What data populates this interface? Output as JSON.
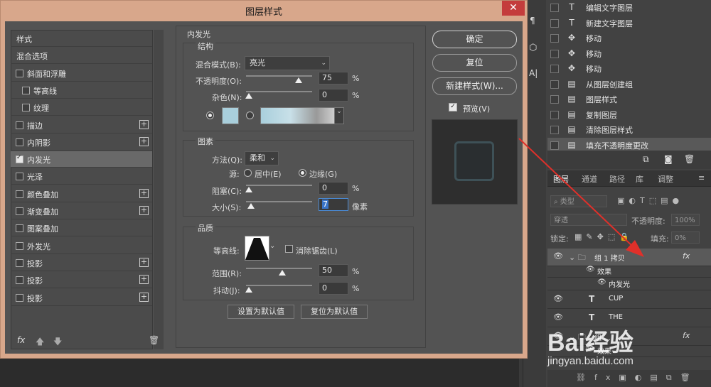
{
  "history": {
    "items": [
      {
        "icon": "T",
        "label": "编辑文字图层"
      },
      {
        "icon": "T",
        "label": "新建文字图层"
      },
      {
        "icon": "✥",
        "label": "移动"
      },
      {
        "icon": "✥",
        "label": "移动"
      },
      {
        "icon": "✥",
        "label": "移动"
      },
      {
        "icon": "▤",
        "label": "从图层创建组"
      },
      {
        "icon": "▤",
        "label": "图层样式"
      },
      {
        "icon": "▤",
        "label": "复制图层"
      },
      {
        "icon": "▤",
        "label": "清除图层样式"
      },
      {
        "icon": "▤",
        "label": "填充不透明度更改"
      }
    ]
  },
  "layers_panel": {
    "tabs": [
      "图层",
      "通道",
      "路径",
      "库",
      "调整"
    ],
    "filter_placeholder": "类型",
    "blend": "穿透",
    "opacity_label": "不透明度:",
    "opacity_value": "100%",
    "lock_label": "锁定:",
    "fill_label": "填充:",
    "fill_value": "0%",
    "rows": [
      {
        "name": "组 1 拷贝",
        "type": "group",
        "fx": "fx"
      },
      {
        "name": "效果",
        "type": "effect"
      },
      {
        "name": "内发光",
        "type": "effect"
      },
      {
        "name": "CUP",
        "type": "text"
      },
      {
        "name": "THE",
        "type": "text"
      },
      {
        "name": "组 ...",
        "type": "group",
        "fx": "fx"
      },
      {
        "name": "效果",
        "type": "effect"
      }
    ]
  },
  "dialog": {
    "title": "图层样式",
    "close": "✕",
    "left_list": [
      {
        "label": "样式",
        "checkbox": false,
        "plus": false,
        "indent": 0
      },
      {
        "label": "混合选项",
        "checkbox": false,
        "plus": false,
        "indent": 0
      },
      {
        "label": "斜面和浮雕",
        "checkbox": true,
        "checked": false,
        "plus": false,
        "indent": 0
      },
      {
        "label": "等高线",
        "checkbox": true,
        "checked": false,
        "plus": false,
        "indent": 1
      },
      {
        "label": "纹理",
        "checkbox": true,
        "checked": false,
        "plus": false,
        "indent": 1
      },
      {
        "label": "描边",
        "checkbox": true,
        "checked": false,
        "plus": true,
        "indent": 0
      },
      {
        "label": "内阴影",
        "checkbox": true,
        "checked": false,
        "plus": true,
        "indent": 0
      },
      {
        "label": "内发光",
        "checkbox": true,
        "checked": true,
        "plus": false,
        "indent": 0,
        "selected": true
      },
      {
        "label": "光泽",
        "checkbox": true,
        "checked": false,
        "plus": false,
        "indent": 0
      },
      {
        "label": "颜色叠加",
        "checkbox": true,
        "checked": false,
        "plus": true,
        "indent": 0
      },
      {
        "label": "渐变叠加",
        "checkbox": true,
        "checked": false,
        "plus": true,
        "indent": 0
      },
      {
        "label": "图案叠加",
        "checkbox": true,
        "checked": false,
        "plus": false,
        "indent": 0
      },
      {
        "label": "外发光",
        "checkbox": true,
        "checked": false,
        "plus": false,
        "indent": 0
      },
      {
        "label": "投影",
        "checkbox": true,
        "checked": false,
        "plus": true,
        "indent": 0
      },
      {
        "label": "投影",
        "checkbox": true,
        "checked": false,
        "plus": true,
        "indent": 0
      },
      {
        "label": "投影",
        "checkbox": true,
        "checked": false,
        "plus": true,
        "indent": 0
      }
    ],
    "fx_label": "fx",
    "section_title": "内发光",
    "structure": {
      "title": "结构",
      "blend_label": "混合模式(B):",
      "blend_value": "亮光",
      "opacity_label": "不透明度(O):",
      "opacity_value": "75",
      "opacity_level": 0.75,
      "noise_label": "杂色(N):",
      "noise_value": "0",
      "noise_level": 0,
      "percent": "%",
      "color_swatch": "#a9cfdc"
    },
    "elements": {
      "title": "图素",
      "method_label": "方法(Q):",
      "method_value": "柔和",
      "source_label": "源:",
      "source_center": "居中(E)",
      "source_edge": "边缘(G)",
      "choke_label": "阻塞(C):",
      "choke_value": "0",
      "choke_level": 0,
      "size_label": "大小(S):",
      "size_value": "7",
      "size_level": 0.03,
      "px_label": "像素"
    },
    "quality": {
      "title": "品质",
      "contour_label": "等高线:",
      "antialias_label": "消除锯齿(L)",
      "range_label": "范围(R):",
      "range_value": "50",
      "range_level": 0.5,
      "jitter_label": "抖动(J):",
      "jitter_value": "0",
      "jitter_level": 0
    },
    "make_default": "设置为默认值",
    "reset_default": "复位为默认值",
    "ok": "确定",
    "reset": "复位",
    "new_style": "新建样式(W)...",
    "preview_label": "预览(V)"
  },
  "watermark": {
    "brand": "Bai经验",
    "url": "jingyan.baidu.com"
  },
  "colors": {
    "arrow": "#e0302a",
    "dialog_frame": "#d8a78b",
    "close": "#c43c3c"
  }
}
